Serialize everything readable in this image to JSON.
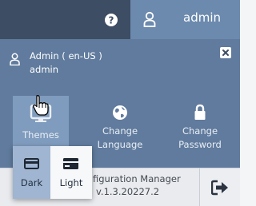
{
  "topbar": {
    "help_icon": "question-circle-icon",
    "user_icon": "user-icon",
    "username": "admin"
  },
  "panel": {
    "user_line1": "Admin ( en-US )",
    "user_line2": "admin",
    "close_icon": "close-icon",
    "tiles": [
      {
        "label": "Themes",
        "icon": "monitor-icon"
      },
      {
        "label_line1": "Change",
        "label_line2": "Language",
        "icon": "globe-icon"
      },
      {
        "label_line1": "Change",
        "label_line2": "Password",
        "icon": "lock-icon"
      }
    ]
  },
  "theme_menu": {
    "options": [
      {
        "label": "Dark",
        "icon": "card-dark-icon"
      },
      {
        "label": "Light",
        "icon": "card-light-icon"
      }
    ]
  },
  "status": {
    "app_name_partial": "figuration Manager",
    "version": "v.1.3.20227.2",
    "logout_icon": "logout-icon"
  },
  "colors": {
    "topbar_bg": "#3d4d63",
    "user_button_bg": "#6c8aae",
    "panel_bg": "#607b9d",
    "active_tile_bg": "#7f9bbd",
    "dark_option_bg": "#9fb5d1"
  }
}
